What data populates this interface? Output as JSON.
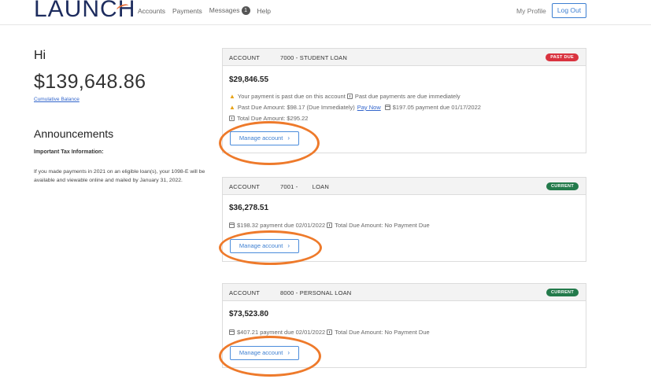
{
  "header": {
    "logo": "LAUNCH",
    "nav": [
      "Accounts",
      "Payments",
      "Messages",
      "Help"
    ],
    "messages_count": "1",
    "my_profile": "My Profile",
    "logout": "Log Out"
  },
  "summary": {
    "greeting": "Hi",
    "balance": "$139,648.86",
    "balance_label": "Cumulative Balance"
  },
  "announcements": {
    "title": "Announcements",
    "item_title": "Important Tax Information:",
    "item_body": "If you made payments in 2021 on an eligible loan(s), your 1098-E will be available and viewable online and mailed by January 31, 2022."
  },
  "accounts": [
    {
      "label": "ACCOUNT",
      "name": "7000 - STUDENT LOAN",
      "status": "PAST DUE",
      "status_color": "#d9333f",
      "amount": "$29,846.55",
      "line1_a": "Your payment is past due on this account",
      "line1_b": "Past due payments are due immediately",
      "line2_a": "Past Due Amount: $98.17 (Due Immediately)",
      "line2_link": "Pay Now",
      "line2_b": "$197.05 payment due 01/17/2022",
      "line3": "Total Due Amount: $295.22",
      "manage": "Manage account"
    },
    {
      "label": "ACCOUNT",
      "name": "7001 -        LOAN",
      "status": "CURRENT",
      "status_color": "#237a4b",
      "amount": "$36,278.51",
      "line1_a": "$198.32 payment due 02/01/2022",
      "line1_b": "Total Due Amount: No Payment Due",
      "manage": "Manage account"
    },
    {
      "label": "ACCOUNT",
      "name": "8000 - PERSONAL LOAN",
      "status": "CURRENT",
      "status_color": "#237a4b",
      "amount": "$73,523.80",
      "line1_a": "$407.21 payment due 02/01/2022",
      "line1_b": "Total Due Amount: No Payment Due",
      "manage": "Manage account"
    }
  ],
  "annotation_color": "#ee7a2b"
}
